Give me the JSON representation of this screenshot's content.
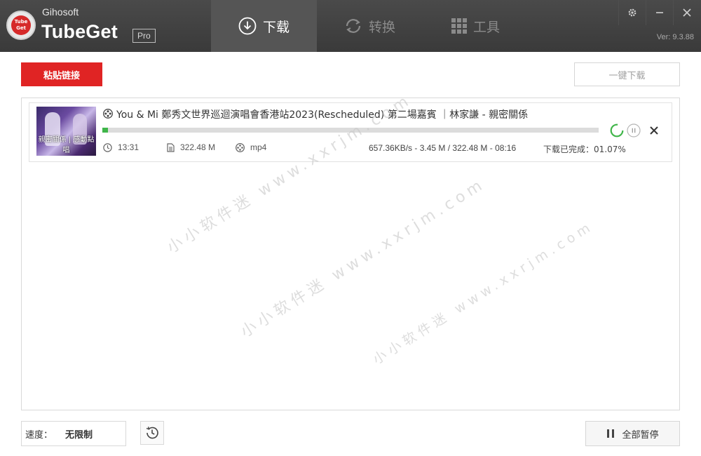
{
  "header": {
    "brand_small": "Gihosoft",
    "brand_name": "TubeGet",
    "badge": "Pro",
    "logo_text_1": "Tube",
    "logo_text_2": "Get",
    "version": "Ver: 9.3.88",
    "tabs": [
      {
        "label": "下载",
        "icon": "download-circle-icon",
        "active": true
      },
      {
        "label": "转换",
        "icon": "convert-arrows-icon",
        "active": false
      },
      {
        "label": "工具",
        "icon": "grid-icon",
        "active": false
      }
    ],
    "window_controls": [
      "gear-icon",
      "minimize-icon",
      "close-icon"
    ]
  },
  "toolbar": {
    "paste_label": "粘贴链接",
    "onekey_label": "一键下载"
  },
  "downloads": [
    {
      "title": "You & Mi 鄭秀文世界巡迴演唱會香港站2023(Rescheduled) 第二場嘉賓 ｜林家謙 - 親密關係",
      "thumbnail_caption": "親密關係 | 感動點唱",
      "duration": "13:31",
      "size": "322.48 M",
      "format": "mp4",
      "speed_info": "657.36KB/s - 3.45 M / 322.48 M - 08:16",
      "completed_text": "下载已完成：01.07%",
      "progress_percent": 1.07
    }
  ],
  "watermarks": [
    "小小软件迷  www.xxrjm.com",
    "小小软件迷  www.xxrjm.com",
    "小小软件迷  www.xxrjm.com"
  ],
  "footer": {
    "speed_label": "速度：",
    "speed_value": "无限制",
    "pause_all_label": "全部暂停"
  },
  "colors": {
    "accent_red": "#e02424",
    "progress_green": "#3fb549",
    "header_bg": "#404040"
  }
}
